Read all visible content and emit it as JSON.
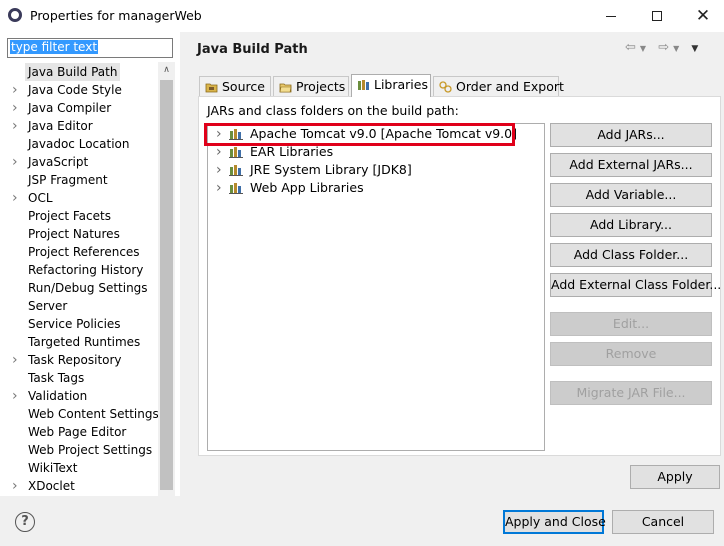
{
  "window": {
    "title": "Properties for managerWeb",
    "controls": [
      "minimize",
      "maximize",
      "close"
    ]
  },
  "filter": {
    "value": "type filter text"
  },
  "nav_tree": [
    {
      "label": "Java Build Path",
      "expandable": false,
      "selected": true
    },
    {
      "label": "Java Code Style",
      "expandable": true
    },
    {
      "label": "Java Compiler",
      "expandable": true
    },
    {
      "label": "Java Editor",
      "expandable": true
    },
    {
      "label": "Javadoc Location",
      "expandable": false
    },
    {
      "label": "JavaScript",
      "expandable": true
    },
    {
      "label": "JSP Fragment",
      "expandable": false
    },
    {
      "label": "OCL",
      "expandable": true
    },
    {
      "label": "Project Facets",
      "expandable": false
    },
    {
      "label": "Project Natures",
      "expandable": false
    },
    {
      "label": "Project References",
      "expandable": false
    },
    {
      "label": "Refactoring History",
      "expandable": false
    },
    {
      "label": "Run/Debug Settings",
      "expandable": false
    },
    {
      "label": "Server",
      "expandable": false
    },
    {
      "label": "Service Policies",
      "expandable": false
    },
    {
      "label": "Targeted Runtimes",
      "expandable": false
    },
    {
      "label": "Task Repository",
      "expandable": true
    },
    {
      "label": "Task Tags",
      "expandable": false
    },
    {
      "label": "Validation",
      "expandable": true
    },
    {
      "label": "Web Content Settings",
      "expandable": false
    },
    {
      "label": "Web Page Editor",
      "expandable": false
    },
    {
      "label": "Web Project Settings",
      "expandable": false
    },
    {
      "label": "WikiText",
      "expandable": false
    },
    {
      "label": "XDoclet",
      "expandable": true
    }
  ],
  "page": {
    "title": "Java Build Path",
    "tabs": [
      {
        "label": "Source",
        "icon": "source-folder-icon"
      },
      {
        "label": "Projects",
        "icon": "projects-folder-icon"
      },
      {
        "label": "Libraries",
        "icon": "libraries-icon",
        "active": true
      },
      {
        "label": "Order and Export",
        "icon": "order-export-icon"
      }
    ],
    "jars_label": "JARs and class folders on the build path:",
    "libraries": [
      {
        "label": "Apache Tomcat v9.0 [Apache Tomcat v9.0]",
        "highlighted": true
      },
      {
        "label": "EAR Libraries"
      },
      {
        "label": "JRE System Library [JDK8]"
      },
      {
        "label": "Web App Libraries"
      }
    ],
    "buttons": {
      "add_jars": "Add JARs...",
      "add_external_jars": "Add External JARs...",
      "add_variable": "Add Variable...",
      "add_library": "Add Library...",
      "add_class_folder": "Add Class Folder...",
      "add_external_class_folder": "Add External Class Folder...",
      "edit": "Edit...",
      "remove": "Remove",
      "migrate_jar": "Migrate JAR File..."
    },
    "apply": "Apply"
  },
  "footer": {
    "help_symbol": "?",
    "apply_close": "Apply and Close",
    "cancel": "Cancel"
  },
  "colors": {
    "highlight_border": "#e0001a",
    "selection_blue": "#3399ff",
    "default_button_border": "#0078d7"
  }
}
